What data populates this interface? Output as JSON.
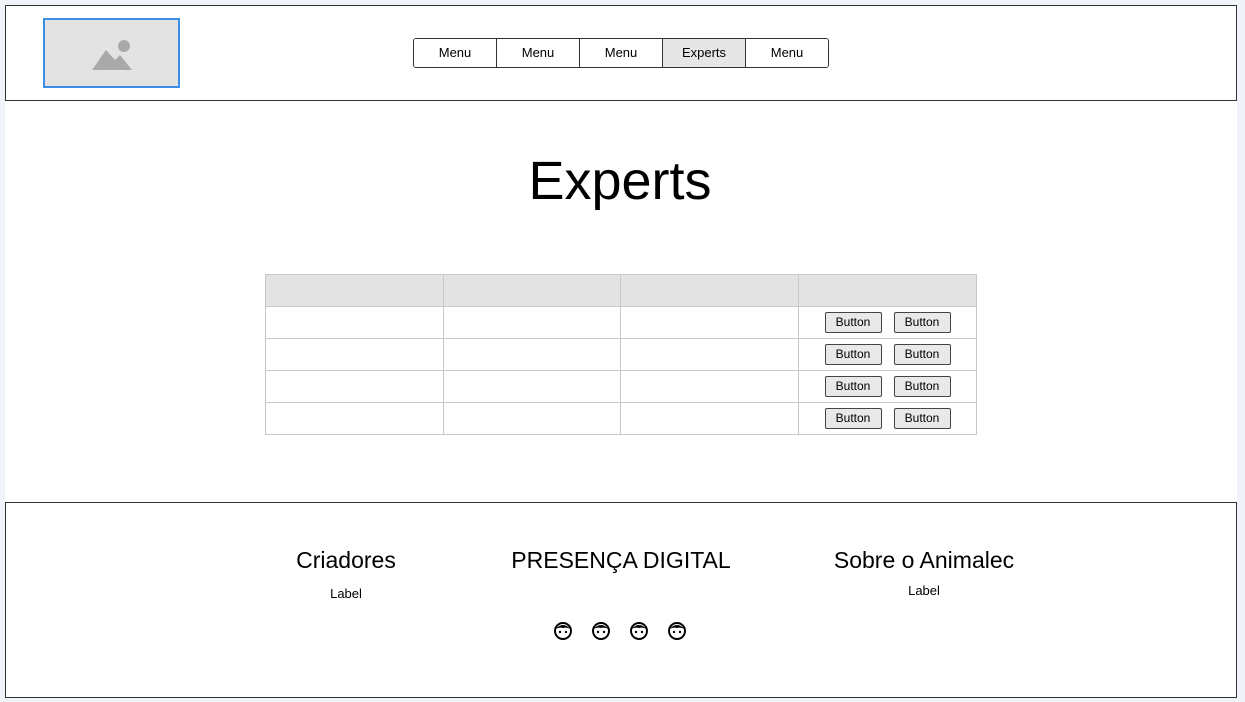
{
  "header": {
    "logo_icon": "image-placeholder-icon",
    "nav": [
      {
        "label": "Menu",
        "active": false
      },
      {
        "label": "Menu",
        "active": false
      },
      {
        "label": "Menu",
        "active": false
      },
      {
        "label": "Experts",
        "active": true
      },
      {
        "label": "Menu",
        "active": false
      }
    ]
  },
  "main": {
    "title": "Experts",
    "table": {
      "headers": [
        "",
        "",
        "",
        ""
      ],
      "rows": [
        {
          "cells": [
            "",
            "",
            ""
          ],
          "actions": [
            "Button",
            "Button"
          ]
        },
        {
          "cells": [
            "",
            "",
            ""
          ],
          "actions": [
            "Button",
            "Button"
          ]
        },
        {
          "cells": [
            "",
            "",
            ""
          ],
          "actions": [
            "Button",
            "Button"
          ]
        },
        {
          "cells": [
            "",
            "",
            ""
          ],
          "actions": [
            "Button",
            "Button"
          ]
        }
      ]
    }
  },
  "footer": {
    "creators": {
      "heading": "Criadores",
      "label": "Label"
    },
    "digital": {
      "heading": "PRESENÇA DIGITAL",
      "icons": [
        "user-face-icon",
        "user-face-icon",
        "user-face-icon",
        "user-face-icon"
      ]
    },
    "about": {
      "heading": "Sobre o Animalec",
      "label": "Label"
    }
  },
  "colors": {
    "accent": "#3a8ee6",
    "header_bg": "#e3e3e3",
    "active_nav_bg": "#e6e6e6"
  }
}
